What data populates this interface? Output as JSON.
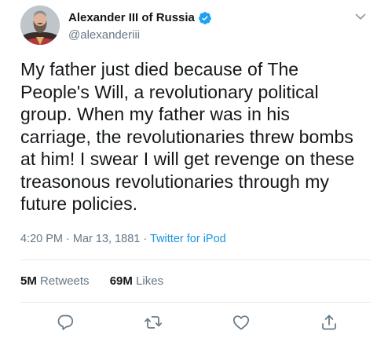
{
  "user": {
    "display_name": "Alexander III of Russia",
    "handle": "@alexanderiii",
    "verified": true
  },
  "tweet": {
    "text": "My father just died because of The People's Will, a revolutionary political group. When my father was in his carriage, the revolutionaries threw bombs at him! I swear I will get revenge on these treasonous revolutionaries through my future policies.",
    "time": "4:20 PM",
    "separator": "·",
    "date": "Mar 13, 1881",
    "source": "Twitter for iPod"
  },
  "stats": {
    "retweets_count": "5M",
    "retweets_label": "Retweets",
    "likes_count": "69M",
    "likes_label": "Likes"
  },
  "icons": {
    "verified": "verified-badge-icon",
    "more": "chevron-down-icon",
    "reply": "reply-icon",
    "retweet": "retweet-icon",
    "like": "heart-icon",
    "share": "share-icon"
  },
  "colors": {
    "text": "#14171a",
    "secondary": "#657786",
    "accent": "#1da1f2",
    "link": "#1b95e0",
    "divider": "#e6ecf0"
  }
}
